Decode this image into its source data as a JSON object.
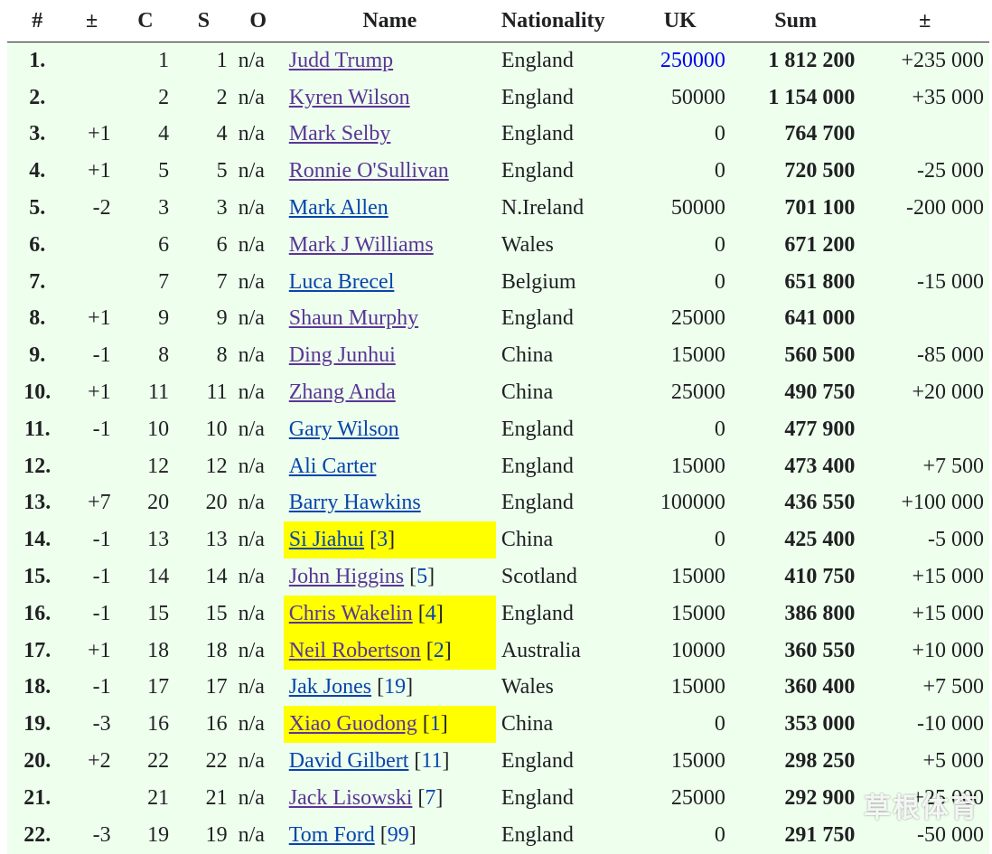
{
  "headers": [
    "#",
    "±",
    "C",
    "S",
    "O",
    "Name",
    "Nationality",
    "UK",
    "Sum",
    "±"
  ],
  "rows": [
    {
      "rank": "1.",
      "chg": "",
      "c": "1",
      "s": "1",
      "o": "n/a",
      "name": "Judd Trump",
      "ref": "",
      "nat": "England",
      "uk": "250000",
      "uk_link": true,
      "sum": "1 812 200",
      "diff": "+235 000",
      "visited": true,
      "hl": false
    },
    {
      "rank": "2.",
      "chg": "",
      "c": "2",
      "s": "2",
      "o": "n/a",
      "name": "Kyren Wilson",
      "ref": "",
      "nat": "England",
      "uk": "50000",
      "uk_link": false,
      "sum": "1 154 000",
      "diff": "+35 000",
      "visited": true,
      "hl": false
    },
    {
      "rank": "3.",
      "chg": "+1",
      "c": "4",
      "s": "4",
      "o": "n/a",
      "name": "Mark Selby",
      "ref": "",
      "nat": "England",
      "uk": "0",
      "uk_link": false,
      "sum": "764 700",
      "diff": "",
      "visited": true,
      "hl": false
    },
    {
      "rank": "4.",
      "chg": "+1",
      "c": "5",
      "s": "5",
      "o": "n/a",
      "name": "Ronnie O'Sullivan",
      "ref": "",
      "nat": "England",
      "uk": "0",
      "uk_link": false,
      "sum": "720 500",
      "diff": "-25 000",
      "visited": true,
      "hl": false
    },
    {
      "rank": "5.",
      "chg": "-2",
      "c": "3",
      "s": "3",
      "o": "n/a",
      "name": "Mark Allen",
      "ref": "",
      "nat": "N.Ireland",
      "uk": "50000",
      "uk_link": false,
      "sum": "701 100",
      "diff": "-200 000",
      "visited": false,
      "hl": false
    },
    {
      "rank": "6.",
      "chg": "",
      "c": "6",
      "s": "6",
      "o": "n/a",
      "name": "Mark J Williams",
      "ref": "",
      "nat": "Wales",
      "uk": "0",
      "uk_link": false,
      "sum": "671 200",
      "diff": "",
      "visited": true,
      "hl": false
    },
    {
      "rank": "7.",
      "chg": "",
      "c": "7",
      "s": "7",
      "o": "n/a",
      "name": "Luca Brecel",
      "ref": "",
      "nat": "Belgium",
      "uk": "0",
      "uk_link": false,
      "sum": "651 800",
      "diff": "-15 000",
      "visited": false,
      "hl": false
    },
    {
      "rank": "8.",
      "chg": "+1",
      "c": "9",
      "s": "9",
      "o": "n/a",
      "name": "Shaun Murphy",
      "ref": "",
      "nat": "England",
      "uk": "25000",
      "uk_link": false,
      "sum": "641 000",
      "diff": "",
      "visited": true,
      "hl": false
    },
    {
      "rank": "9.",
      "chg": "-1",
      "c": "8",
      "s": "8",
      "o": "n/a",
      "name": "Ding Junhui",
      "ref": "",
      "nat": "China",
      "uk": "15000",
      "uk_link": false,
      "sum": "560 500",
      "diff": "-85 000",
      "visited": true,
      "hl": false
    },
    {
      "rank": "10.",
      "chg": "+1",
      "c": "11",
      "s": "11",
      "o": "n/a",
      "name": "Zhang Anda",
      "ref": "",
      "nat": "China",
      "uk": "25000",
      "uk_link": false,
      "sum": "490 750",
      "diff": "+20 000",
      "visited": true,
      "hl": false
    },
    {
      "rank": "11.",
      "chg": "-1",
      "c": "10",
      "s": "10",
      "o": "n/a",
      "name": "Gary Wilson",
      "ref": "",
      "nat": "England",
      "uk": "0",
      "uk_link": false,
      "sum": "477 900",
      "diff": "",
      "visited": false,
      "hl": false
    },
    {
      "rank": "12.",
      "chg": "",
      "c": "12",
      "s": "12",
      "o": "n/a",
      "name": "Ali Carter",
      "ref": "",
      "nat": "England",
      "uk": "15000",
      "uk_link": false,
      "sum": "473 400",
      "diff": "+7 500",
      "visited": false,
      "hl": false
    },
    {
      "rank": "13.",
      "chg": "+7",
      "c": "20",
      "s": "20",
      "o": "n/a",
      "name": "Barry Hawkins",
      "ref": "",
      "nat": "England",
      "uk": "100000",
      "uk_link": false,
      "sum": "436 550",
      "diff": "+100 000",
      "visited": false,
      "hl": false
    },
    {
      "rank": "14.",
      "chg": "-1",
      "c": "13",
      "s": "13",
      "o": "n/a",
      "name": "Si Jiahui",
      "ref": "3",
      "nat": "China",
      "uk": "0",
      "uk_link": false,
      "sum": "425 400",
      "diff": "-5 000",
      "visited": false,
      "hl": true
    },
    {
      "rank": "15.",
      "chg": "-1",
      "c": "14",
      "s": "14",
      "o": "n/a",
      "name": "John Higgins",
      "ref": "5",
      "nat": "Scotland",
      "uk": "15000",
      "uk_link": false,
      "sum": "410 750",
      "diff": "+15 000",
      "visited": true,
      "hl": false
    },
    {
      "rank": "16.",
      "chg": "-1",
      "c": "15",
      "s": "15",
      "o": "n/a",
      "name": "Chris Wakelin",
      "ref": "4",
      "nat": "England",
      "uk": "15000",
      "uk_link": false,
      "sum": "386 800",
      "diff": "+15 000",
      "visited": true,
      "hl": true
    },
    {
      "rank": "17.",
      "chg": "+1",
      "c": "18",
      "s": "18",
      "o": "n/a",
      "name": "Neil Robertson",
      "ref": "2",
      "nat": "Australia",
      "uk": "10000",
      "uk_link": false,
      "sum": "360 550",
      "diff": "+10 000",
      "visited": true,
      "hl": true
    },
    {
      "rank": "18.",
      "chg": "-1",
      "c": "17",
      "s": "17",
      "o": "n/a",
      "name": "Jak Jones",
      "ref": "19",
      "nat": "Wales",
      "uk": "15000",
      "uk_link": false,
      "sum": "360 400",
      "diff": "+7 500",
      "visited": false,
      "hl": false
    },
    {
      "rank": "19.",
      "chg": "-3",
      "c": "16",
      "s": "16",
      "o": "n/a",
      "name": "Xiao Guodong",
      "ref": "1",
      "nat": "China",
      "uk": "0",
      "uk_link": false,
      "sum": "353 000",
      "diff": "-10 000",
      "visited": true,
      "hl": true
    },
    {
      "rank": "20.",
      "chg": "+2",
      "c": "22",
      "s": "22",
      "o": "n/a",
      "name": "David Gilbert",
      "ref": "11",
      "nat": "England",
      "uk": "15000",
      "uk_link": false,
      "sum": "298 250",
      "diff": "+5 000",
      "visited": false,
      "hl": false
    },
    {
      "rank": "21.",
      "chg": "",
      "c": "21",
      "s": "21",
      "o": "n/a",
      "name": "Jack Lisowski",
      "ref": "7",
      "nat": "England",
      "uk": "25000",
      "uk_link": false,
      "sum": "292 900",
      "diff": "+25 000",
      "visited": true,
      "hl": false
    },
    {
      "rank": "22.",
      "chg": "-3",
      "c": "19",
      "s": "19",
      "o": "n/a",
      "name": "Tom Ford",
      "ref": "99",
      "nat": "England",
      "uk": "0",
      "uk_link": false,
      "sum": "291 750",
      "diff": "-50 000",
      "visited": false,
      "hl": false
    }
  ],
  "watermark": "草根体育",
  "colors": {
    "row_bg": "#eeffee",
    "highlight": "#ffff00",
    "link": "#0645ad",
    "visited": "#5a3696"
  }
}
